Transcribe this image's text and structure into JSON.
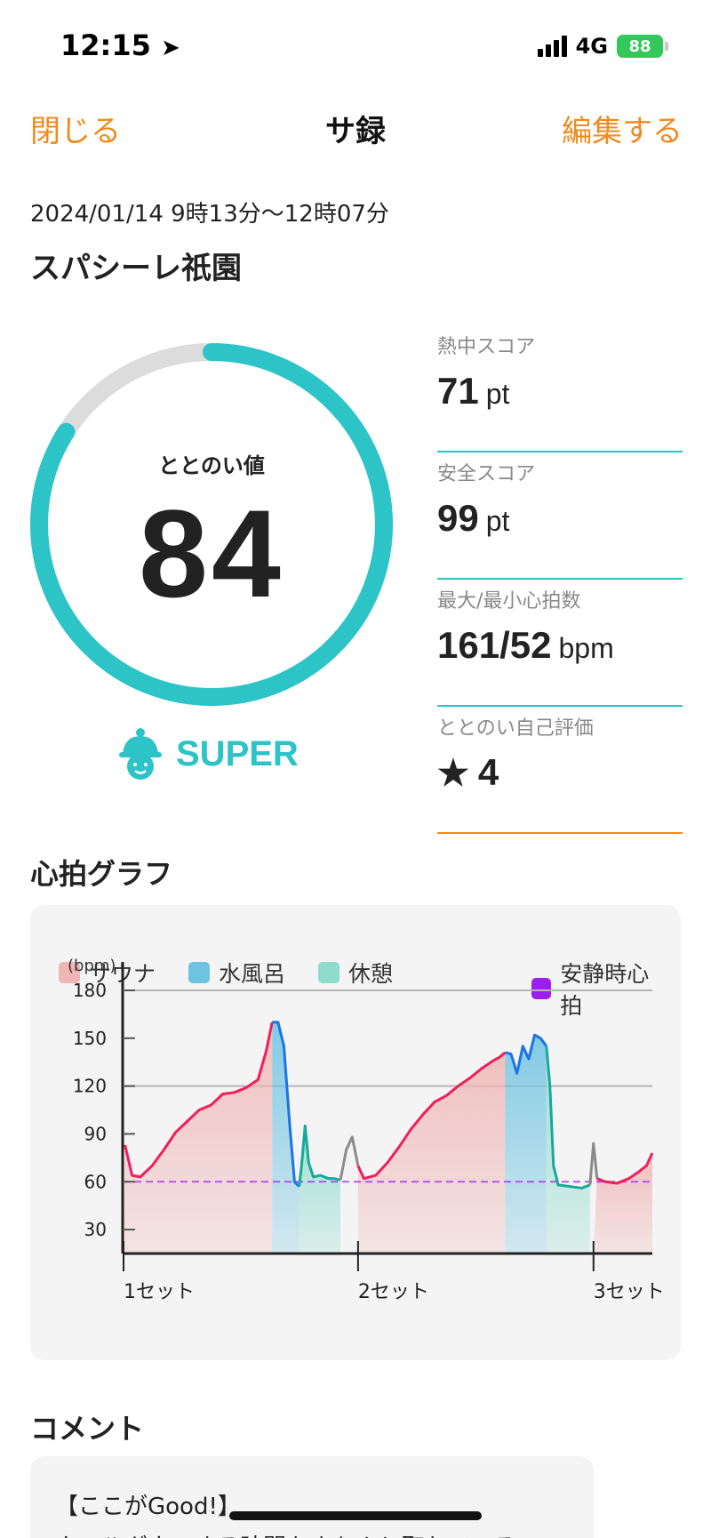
{
  "status": {
    "time": "12:15",
    "network": "4G",
    "battery": "88"
  },
  "nav": {
    "close": "閉じる",
    "title": "サ録",
    "edit": "編集する"
  },
  "session": {
    "date": "2024/01/14 9時13分〜12時07分",
    "place": "スパシーレ祇園"
  },
  "score": {
    "label": "ととのい値",
    "value": "84",
    "rank": "SUPER",
    "fraction": 0.84
  },
  "stats": [
    {
      "label": "熱中スコア",
      "value": "71",
      "unit": "pt"
    },
    {
      "label": "安全スコア",
      "value": "99",
      "unit": "pt"
    },
    {
      "label": "最大/最小心拍数",
      "value": "161/52",
      "unit": "bpm"
    },
    {
      "label": "ととのい自己評価",
      "star": "★",
      "value": "4",
      "unit": ""
    }
  ],
  "heart_section": {
    "title": "心拍グラフ"
  },
  "colors": {
    "accent": "#f08a1c",
    "teal": "#2cc4c7",
    "sauna": "#f0b5b5",
    "water": "#6ec3e2",
    "rest": "#8fdccd",
    "resting_hr": "#9b1ff2",
    "sauna_line": "#ee1f5d"
  },
  "chart_data": {
    "type": "line",
    "legend": [
      {
        "name": "サウナ",
        "color": "#f0b5b5"
      },
      {
        "name": "水風呂",
        "color": "#6ec3e2"
      },
      {
        "name": "休憩",
        "color": "#8fdccd"
      },
      {
        "name": "安静時心拍",
        "color": "#9b1ff2"
      }
    ],
    "ylabel": "(bpm)",
    "yticks": [
      180,
      150,
      120,
      90,
      60,
      30
    ],
    "ylim": [
      15,
      180
    ],
    "xticks": [
      "1セット",
      "2セット",
      "3セット"
    ],
    "xlim": [
      0,
      4.5
    ],
    "set_starts": [
      0,
      2.0,
      4.0
    ],
    "resting_hr": 60,
    "segments": [
      {
        "phase": "sauna",
        "start": 0.0,
        "end": 1.27
      },
      {
        "phase": "water",
        "start": 1.27,
        "end": 1.5
      },
      {
        "phase": "rest",
        "start": 1.5,
        "end": 1.85
      },
      {
        "phase": "sauna",
        "start": 2.0,
        "end": 3.25
      },
      {
        "phase": "water",
        "start": 3.25,
        "end": 3.6
      },
      {
        "phase": "rest",
        "start": 3.6,
        "end": 3.97
      },
      {
        "phase": "sauna",
        "start": 4.0,
        "end": 4.5
      }
    ],
    "series": [
      {
        "phase": "sauna",
        "points": [
          [
            0.02,
            83
          ],
          [
            0.08,
            64
          ],
          [
            0.15,
            63
          ],
          [
            0.25,
            70
          ],
          [
            0.35,
            80
          ],
          [
            0.45,
            91
          ],
          [
            0.55,
            98
          ],
          [
            0.65,
            105
          ],
          [
            0.75,
            108
          ],
          [
            0.85,
            115
          ],
          [
            0.95,
            116
          ],
          [
            1.05,
            119
          ],
          [
            1.15,
            124
          ],
          [
            1.22,
            142
          ],
          [
            1.27,
            160
          ]
        ]
      },
      {
        "phase": "water",
        "points": [
          [
            1.27,
            160
          ],
          [
            1.32,
            160
          ],
          [
            1.37,
            145
          ],
          [
            1.42,
            95
          ],
          [
            1.46,
            60
          ],
          [
            1.5,
            57
          ]
        ]
      },
      {
        "phase": "rest",
        "points": [
          [
            1.5,
            57
          ],
          [
            1.52,
            70
          ],
          [
            1.55,
            95
          ],
          [
            1.58,
            72
          ],
          [
            1.62,
            63
          ],
          [
            1.68,
            64
          ],
          [
            1.75,
            62
          ],
          [
            1.8,
            62
          ],
          [
            1.85,
            61
          ]
        ]
      },
      {
        "phase": "other",
        "points": [
          [
            1.85,
            61
          ],
          [
            1.9,
            80
          ],
          [
            1.95,
            88
          ],
          [
            2.0,
            70
          ]
        ]
      },
      {
        "phase": "sauna",
        "points": [
          [
            2.0,
            70
          ],
          [
            2.05,
            62
          ],
          [
            2.15,
            64
          ],
          [
            2.25,
            72
          ],
          [
            2.35,
            82
          ],
          [
            2.45,
            93
          ],
          [
            2.55,
            102
          ],
          [
            2.65,
            110
          ],
          [
            2.75,
            114
          ],
          [
            2.85,
            120
          ],
          [
            2.95,
            125
          ],
          [
            3.05,
            131
          ],
          [
            3.15,
            136
          ],
          [
            3.2,
            138
          ],
          [
            3.25,
            141
          ]
        ]
      },
      {
        "phase": "water",
        "points": [
          [
            3.25,
            141
          ],
          [
            3.3,
            140
          ],
          [
            3.35,
            128
          ],
          [
            3.4,
            145
          ],
          [
            3.45,
            137
          ],
          [
            3.5,
            152
          ],
          [
            3.55,
            150
          ],
          [
            3.6,
            145
          ]
        ]
      },
      {
        "phase": "rest",
        "points": [
          [
            3.6,
            145
          ],
          [
            3.63,
            120
          ],
          [
            3.66,
            70
          ],
          [
            3.7,
            58
          ],
          [
            3.8,
            57
          ],
          [
            3.9,
            56
          ],
          [
            3.97,
            58
          ]
        ]
      },
      {
        "phase": "other",
        "points": [
          [
            3.97,
            58
          ],
          [
            4.0,
            84
          ],
          [
            4.03,
            62
          ]
        ]
      },
      {
        "phase": "sauna",
        "points": [
          [
            4.03,
            62
          ],
          [
            4.1,
            60
          ],
          [
            4.2,
            59
          ],
          [
            4.3,
            62
          ],
          [
            4.38,
            66
          ],
          [
            4.45,
            70
          ],
          [
            4.5,
            78
          ]
        ]
      }
    ]
  },
  "comment": {
    "title": "コメント",
    "line1": "【ここがGood!】",
    "line2": "クールダウンする時間をきちんと取れている"
  }
}
